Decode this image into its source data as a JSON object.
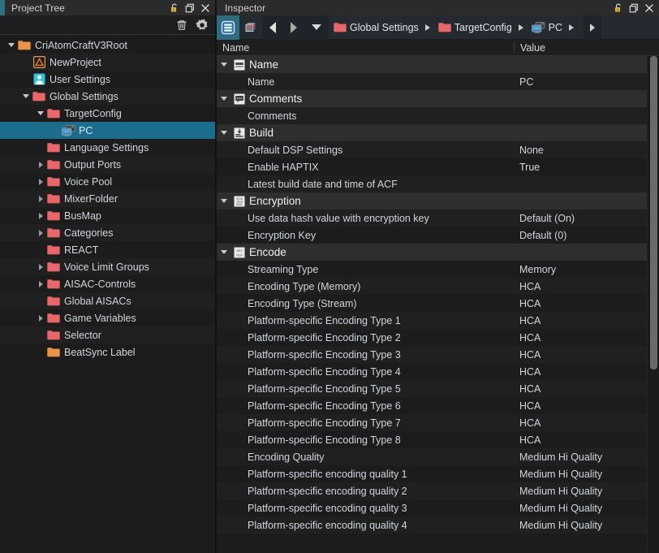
{
  "tree_panel": {
    "title": "Project Tree",
    "titlebar_icons": [
      {
        "name": "lock-icon",
        "label": "Lock"
      },
      {
        "name": "restore-window-icon",
        "label": "Restore"
      },
      {
        "name": "close-icon",
        "label": "Close"
      }
    ],
    "toolbar_icons": [
      {
        "name": "trash-icon",
        "label": "Delete"
      },
      {
        "name": "gear-icon",
        "label": "Settings"
      }
    ],
    "items": [
      {
        "label": "CriAtomCraftV3Root",
        "depth": 0,
        "twisty": "down",
        "icon": "folder-orange"
      },
      {
        "label": "NewProject",
        "depth": 1,
        "twisty": "none",
        "icon": "project-triangle"
      },
      {
        "label": "User Settings",
        "depth": 1,
        "twisty": "none",
        "icon": "user-settings"
      },
      {
        "label": "Global Settings",
        "depth": 1,
        "twisty": "down",
        "icon": "folder-red"
      },
      {
        "label": "TargetConfig",
        "depth": 2,
        "twisty": "down",
        "icon": "folder-red"
      },
      {
        "label": "PC",
        "depth": 3,
        "twisty": "none",
        "icon": "pc-monitor",
        "selected": true
      },
      {
        "label": "Language Settings",
        "depth": 2,
        "twisty": "none",
        "icon": "folder-red"
      },
      {
        "label": "Output Ports",
        "depth": 2,
        "twisty": "right",
        "icon": "folder-red"
      },
      {
        "label": "Voice Pool",
        "depth": 2,
        "twisty": "right",
        "icon": "folder-red"
      },
      {
        "label": "MixerFolder",
        "depth": 2,
        "twisty": "right",
        "icon": "folder-red"
      },
      {
        "label": "BusMap",
        "depth": 2,
        "twisty": "right",
        "icon": "folder-red"
      },
      {
        "label": "Categories",
        "depth": 2,
        "twisty": "right",
        "icon": "folder-red"
      },
      {
        "label": "REACT",
        "depth": 2,
        "twisty": "none",
        "icon": "folder-red"
      },
      {
        "label": "Voice Limit Groups",
        "depth": 2,
        "twisty": "right",
        "icon": "folder-red"
      },
      {
        "label": "AISAC-Controls",
        "depth": 2,
        "twisty": "right",
        "icon": "folder-red"
      },
      {
        "label": "Global AISACs",
        "depth": 2,
        "twisty": "none",
        "icon": "folder-red"
      },
      {
        "label": "Game Variables",
        "depth": 2,
        "twisty": "right",
        "icon": "folder-red"
      },
      {
        "label": "Selector",
        "depth": 2,
        "twisty": "none",
        "icon": "folder-red"
      },
      {
        "label": "BeatSync Label",
        "depth": 2,
        "twisty": "none",
        "icon": "folder-orange"
      }
    ]
  },
  "inspector": {
    "title": "Inspector",
    "titlebar_icons": [
      {
        "name": "lock-icon",
        "label": "Lock"
      },
      {
        "name": "restore-window-icon",
        "label": "Restore"
      },
      {
        "name": "close-icon",
        "label": "Close"
      }
    ],
    "toolbar": {
      "list-view-button": "List View",
      "revert-button": "Revert",
      "back-button": "Back",
      "forward-button": "Forward",
      "dropdown-button": "History"
    },
    "breadcrumb": [
      {
        "label": "Global Settings",
        "icon": "folder-red"
      },
      {
        "label": "TargetConfig",
        "icon": "folder-red"
      },
      {
        "label": "PC",
        "icon": "pc-monitor"
      }
    ],
    "columns": {
      "name": "Name",
      "value": "Value"
    },
    "rows": [
      {
        "name": "Name",
        "value": "",
        "group": true,
        "icon": "name-tag-icon"
      },
      {
        "name": "Name",
        "value": "PC"
      },
      {
        "name": "Comments",
        "value": "",
        "group": true,
        "icon": "comments-icon"
      },
      {
        "name": "Comments",
        "value": ""
      },
      {
        "name": "Build",
        "value": "",
        "group": true,
        "icon": "build-icon"
      },
      {
        "name": "Default DSP Settings",
        "value": "None"
      },
      {
        "name": "Enable HAPTIX",
        "value": "True"
      },
      {
        "name": "Latest build date and time of ACF",
        "value": ""
      },
      {
        "name": "Encryption",
        "value": "",
        "group": true,
        "icon": "encryption-icon"
      },
      {
        "name": "Use data hash value with encryption key",
        "value": "Default (On)"
      },
      {
        "name": "Encryption Key",
        "value": "Default (0)"
      },
      {
        "name": "Encode",
        "value": "",
        "group": true,
        "icon": "encode-icon"
      },
      {
        "name": "Streaming Type",
        "value": "Memory"
      },
      {
        "name": "Encoding Type (Memory)",
        "value": "HCA"
      },
      {
        "name": "Encoding Type (Stream)",
        "value": "HCA"
      },
      {
        "name": "Platform-specific Encoding Type 1",
        "value": "HCA"
      },
      {
        "name": "Platform-specific Encoding Type 2",
        "value": "HCA"
      },
      {
        "name": "Platform-specific Encoding Type 3",
        "value": "HCA"
      },
      {
        "name": "Platform-specific Encoding Type 4",
        "value": "HCA"
      },
      {
        "name": "Platform-specific Encoding Type 5",
        "value": "HCA"
      },
      {
        "name": "Platform-specific Encoding Type 6",
        "value": "HCA"
      },
      {
        "name": "Platform-specific Encoding Type 7",
        "value": "HCA"
      },
      {
        "name": "Platform-specific Encoding Type 8",
        "value": "HCA"
      },
      {
        "name": "Encoding Quality",
        "value": "Medium Hi Quality"
      },
      {
        "name": "Platform-specific encoding quality 1",
        "value": "Medium Hi Quality"
      },
      {
        "name": "Platform-specific encoding quality 2",
        "value": "Medium Hi Quality"
      },
      {
        "name": "Platform-specific encoding quality 3",
        "value": "Medium Hi Quality"
      },
      {
        "name": "Platform-specific encoding quality 4",
        "value": "Medium Hi Quality"
      }
    ],
    "scroll_thumb_percent": 63
  },
  "colors": {
    "selection": "#1c6c8c",
    "folder_red": "#e8676b",
    "folder_orange": "#e8944a",
    "accent": "#2d6b80",
    "panel_bg": "#1c1c1c",
    "row_alt": "#202020",
    "group_row": "#2e2e2e"
  }
}
